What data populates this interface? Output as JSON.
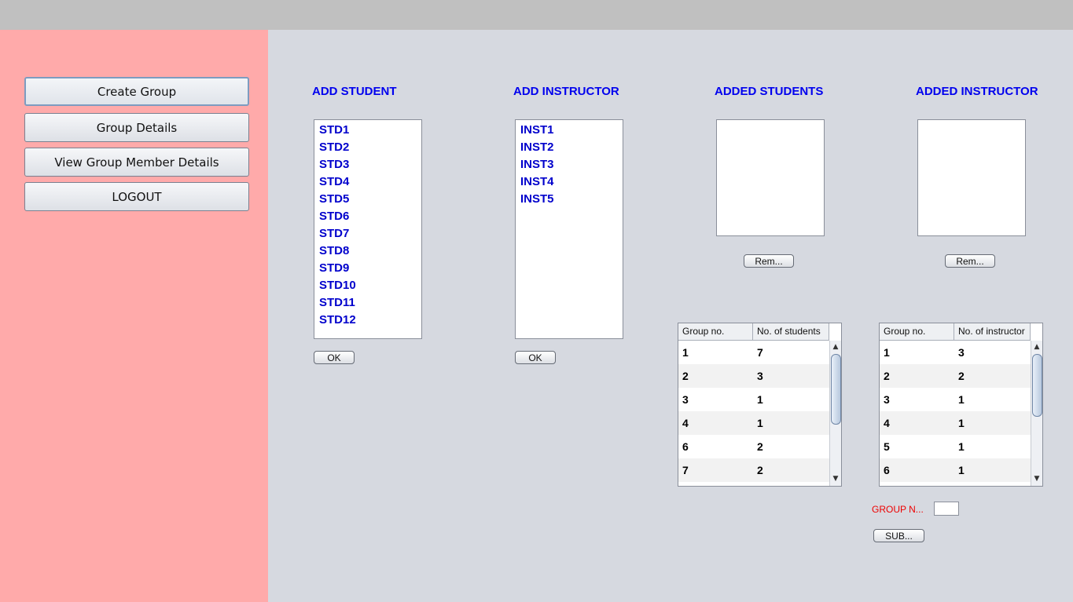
{
  "sidebar": {
    "buttons": [
      {
        "label": "Create Group"
      },
      {
        "label": "Group Details"
      },
      {
        "label": "View Group Member Details"
      },
      {
        "label": "LOGOUT"
      }
    ]
  },
  "add_student": {
    "heading": "ADD STUDENT",
    "items": [
      "STD1",
      "STD2",
      "STD3",
      "STD4",
      "STD5",
      "STD6",
      "STD7",
      "STD8",
      "STD9",
      "STD10",
      "STD11",
      "STD12"
    ],
    "ok_label": "OK"
  },
  "add_instructor": {
    "heading": "ADD INSTRUCTOR",
    "items": [
      "INST1",
      "INST2",
      "INST3",
      "INST4",
      "INST5"
    ],
    "ok_label": "OK"
  },
  "added_students": {
    "heading": "ADDED STUDENTS",
    "remove_label": "Rem..."
  },
  "added_instructor": {
    "heading": "ADDED INSTRUCTOR",
    "remove_label": "Rem..."
  },
  "students_table": {
    "columns": [
      "Group no.",
      "No. of students"
    ],
    "rows": [
      [
        "1",
        "7"
      ],
      [
        "2",
        "3"
      ],
      [
        "3",
        "1"
      ],
      [
        "4",
        "1"
      ],
      [
        "6",
        "2"
      ],
      [
        "7",
        "2"
      ]
    ]
  },
  "instructor_table": {
    "columns": [
      "Group no.",
      "No. of instructor"
    ],
    "rows": [
      [
        "1",
        "3"
      ],
      [
        "2",
        "2"
      ],
      [
        "3",
        "1"
      ],
      [
        "4",
        "1"
      ],
      [
        "5",
        "1"
      ],
      [
        "6",
        "1"
      ]
    ]
  },
  "group_form": {
    "label": "GROUP N...",
    "value": "",
    "submit_label": "SUB..."
  },
  "colors": {
    "sidebar_bg": "#ffaaaa",
    "main_bg": "#d6d9e0",
    "heading_color": "#0000ee",
    "list_item_color": "#0000cc",
    "group_label_color": "#ee0000"
  }
}
